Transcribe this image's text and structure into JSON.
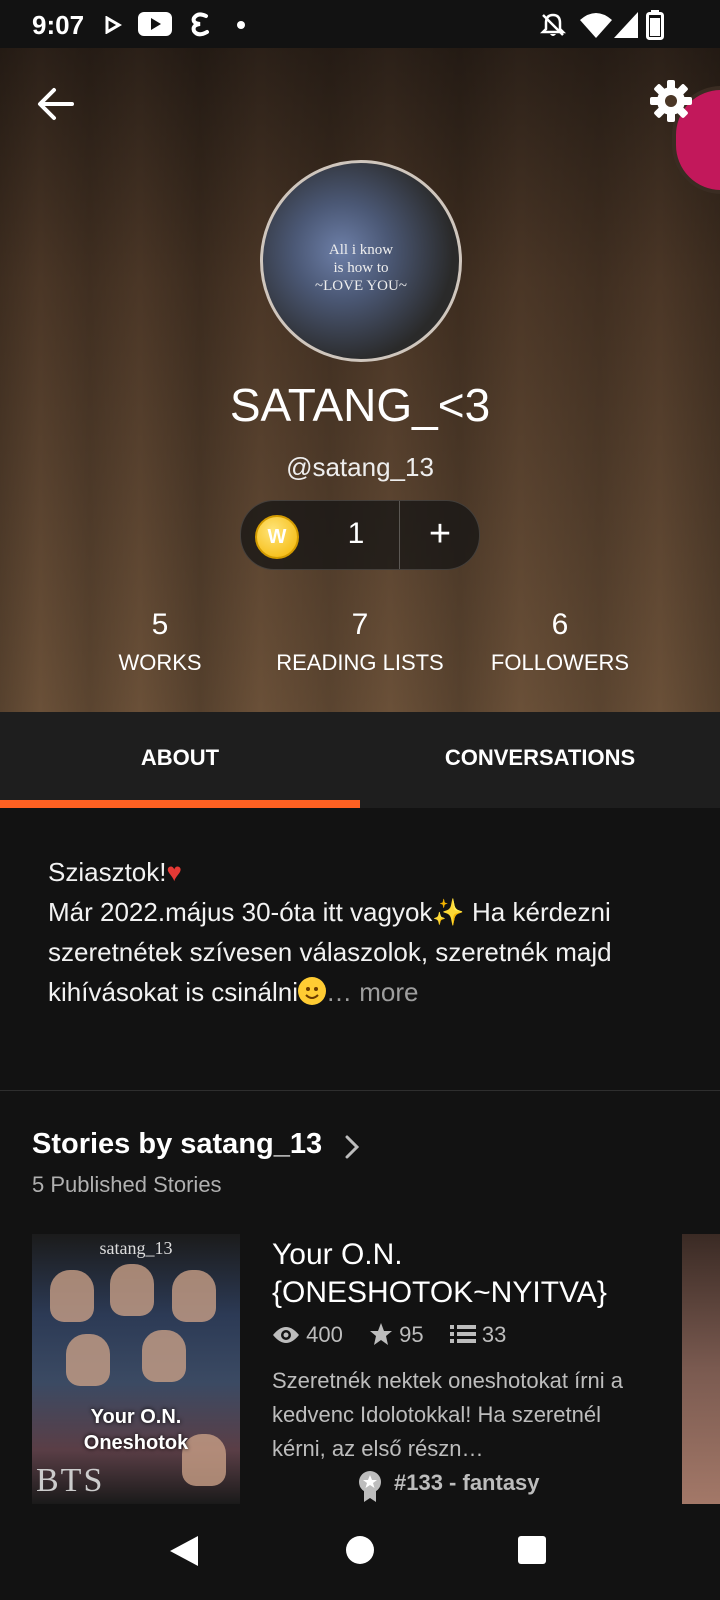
{
  "status_bar": {
    "time": "9:07"
  },
  "profile": {
    "avatar_text_lines": [
      "All i know",
      "is how to",
      "~LOVE YOU~"
    ],
    "display_name": "SATANG_<3",
    "username": "@satang_13",
    "coins": {
      "coin_symbol": "W",
      "count": "1",
      "add_label": "+"
    },
    "stats": [
      {
        "value": "5",
        "label": "WORKS"
      },
      {
        "value": "7",
        "label": "READING LISTS"
      },
      {
        "value": "6",
        "label": "FOLLOWERS"
      }
    ]
  },
  "tabs": [
    {
      "label": "ABOUT",
      "active": true
    },
    {
      "label": "CONVERSATIONS",
      "active": false
    }
  ],
  "about": {
    "line1": "Sziasztok!",
    "line1_emoji": "♥",
    "line2": "Már 2022.május 30-óta itt vagyok",
    "line2_emoji": "✨",
    "line2_cont": " Ha kérdezni szeretnétek szívesen válaszolok, szeretnék majd kihívásokat is csinálni",
    "ellipsis": "…",
    "more_label": " more"
  },
  "stories_section": {
    "title": "Stories by satang_13",
    "subtitle": "5 Published Stories",
    "story": {
      "cover_top": "satang_13",
      "cover_title_line1": "Your O.N.",
      "cover_title_line2": "Oneshotok",
      "cover_bottom": "BTS",
      "title": "Your O.N. {ONESHOTOK~NYITVA}",
      "reads": "400",
      "votes": "95",
      "parts": "33",
      "description": "Szeretnék nektek oneshotokat írni a kedvenc Idolotokkal! Ha szeretnél kérni, az első részn…",
      "rank": "#133 - fantasy"
    }
  },
  "colors": {
    "accent": "#ff6122",
    "background": "#121212",
    "tab_bar": "#1e1e1e",
    "coin": "#f4b400"
  }
}
